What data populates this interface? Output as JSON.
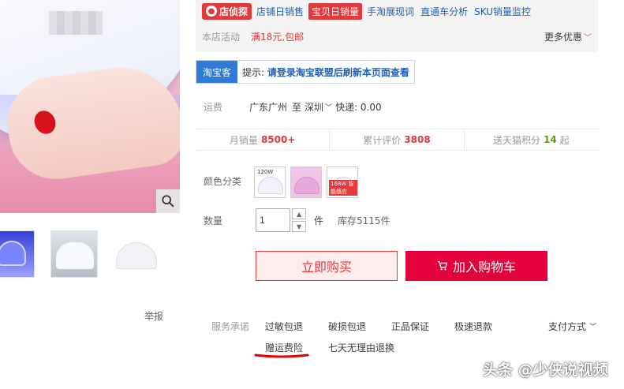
{
  "tools": {
    "spy_badge": "店侦探",
    "links": [
      "店铺日销售",
      "手淘展现词",
      "直通车分析",
      "SKU销量监控"
    ],
    "highlight": "宝贝日销量"
  },
  "activity": {
    "label": "本店活动",
    "value": "满18元,包邮",
    "more": "更多优惠"
  },
  "taobaoke": {
    "badge": "淘宝客",
    "prefix": "提示:",
    "message": "请登录淘宝联盟后刷新本页面查看"
  },
  "shipping": {
    "label": "运费",
    "from": "广东广州",
    "to_label": "至",
    "destination": "深圳",
    "speed": "快递: 0.00"
  },
  "stats": {
    "monthly_sales_label": "月销量",
    "monthly_sales_value": "8500+",
    "reviews_label": "累计评价",
    "reviews_value": "3808",
    "points_label": "送天猫积分",
    "points_value": "14",
    "points_suffix": "起"
  },
  "color": {
    "label": "颜色分类",
    "swatch_tags": [
      "120W",
      "",
      "168W"
    ],
    "swatch3_badge": "168W 智能感应"
  },
  "quantity": {
    "label": "数量",
    "value": "1",
    "unit": "件",
    "stock": "库存5115件"
  },
  "buttons": {
    "buy_now": "立即购买",
    "add_to_cart": "加入购物车"
  },
  "gallery": {
    "report": "举报"
  },
  "services": {
    "label": "服务承诺",
    "items": [
      "过敏包退",
      "破损包退",
      "正品保证",
      "极速退款",
      "赠运费险",
      "七天无理由退换"
    ],
    "payment": "支付方式"
  },
  "watermark": "头条 @少侠说视频",
  "colors": {
    "accent": "#e4393c",
    "cart": "#e4003a",
    "link": "#1e5fb8",
    "green": "#5a9a1a"
  }
}
